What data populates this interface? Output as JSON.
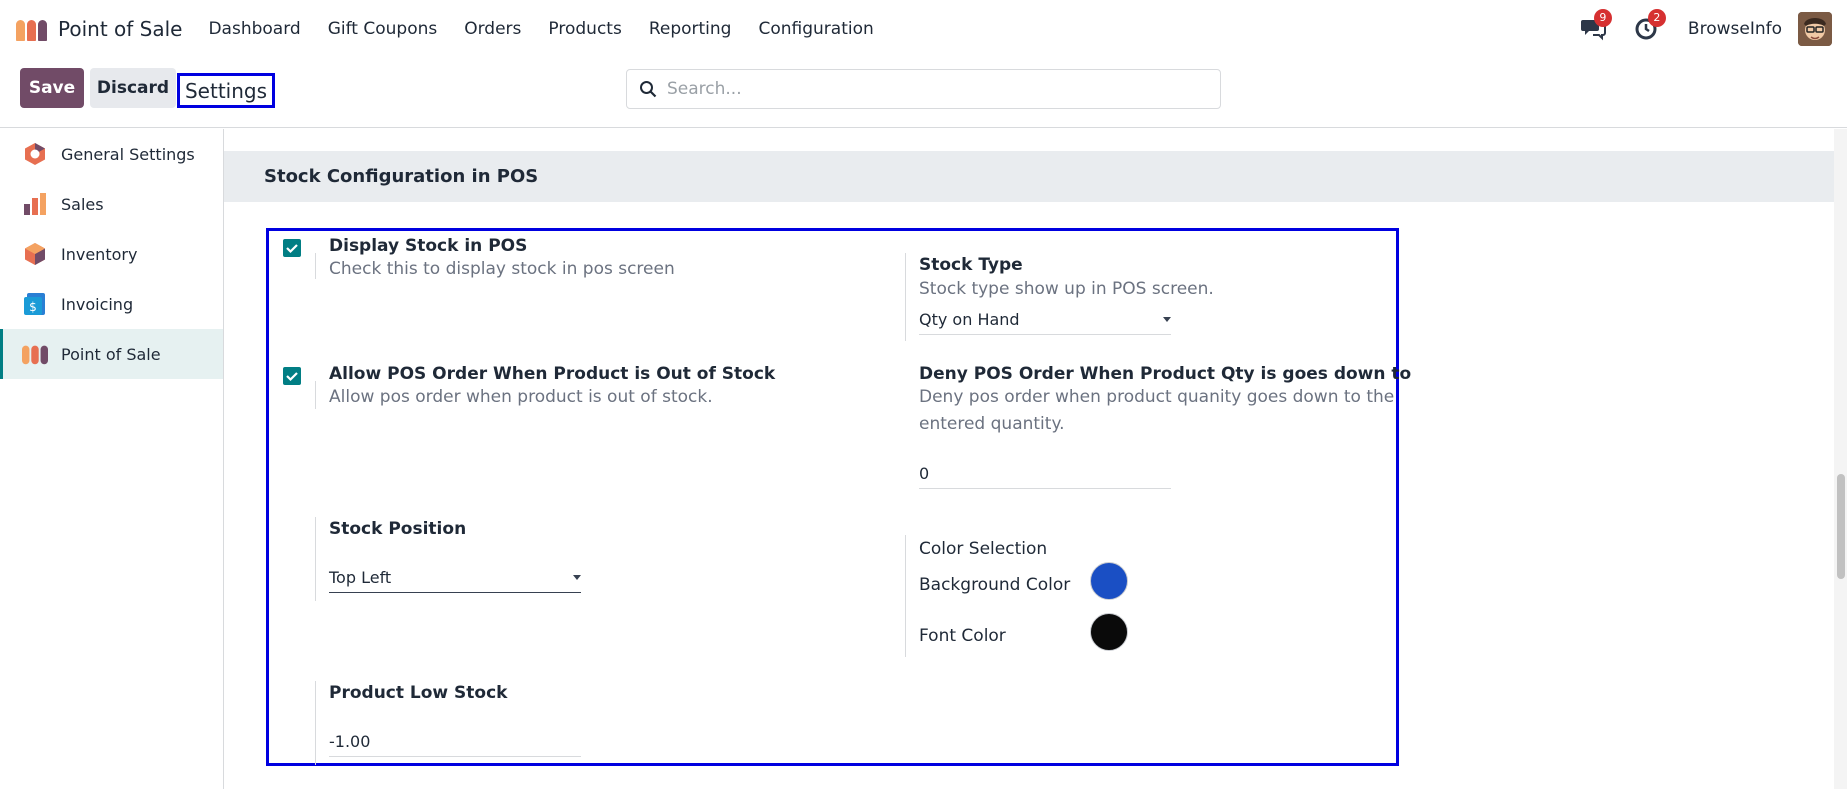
{
  "navbar": {
    "app_title": "Point of Sale",
    "menu": [
      "Dashboard",
      "Gift Coupons",
      "Orders",
      "Products",
      "Reporting",
      "Configuration"
    ],
    "messages_count": "9",
    "activities_count": "2",
    "user_name": "BrowseInfo"
  },
  "control": {
    "save_label": "Save",
    "discard_label": "Discard",
    "breadcrumb": "Settings",
    "search_placeholder": "Search..."
  },
  "sidebar": {
    "items": [
      {
        "label": "General Settings",
        "icon": "general-settings-icon"
      },
      {
        "label": "Sales",
        "icon": "sales-icon"
      },
      {
        "label": "Inventory",
        "icon": "inventory-icon"
      },
      {
        "label": "Invoicing",
        "icon": "invoicing-icon"
      },
      {
        "label": "Point of Sale",
        "icon": "point-of-sale-icon",
        "active": true
      }
    ]
  },
  "section": {
    "title": "Stock Configuration in POS"
  },
  "settings": {
    "display_stock": {
      "title": "Display Stock in POS",
      "desc": "Check this to display stock in pos screen",
      "checked": true
    },
    "stock_type": {
      "title": "Stock Type",
      "desc": "Stock type show up in POS screen.",
      "value": "Qty on Hand"
    },
    "allow_order": {
      "title": "Allow POS Order When Product is Out of Stock",
      "desc": "Allow pos order when product is out of stock.",
      "checked": true
    },
    "deny_order": {
      "title": "Deny POS Order When Product Qty is goes down to",
      "desc_line1": "Deny pos order when product quanity goes down to the",
      "desc_line2": "entered quantity.",
      "value": "0"
    },
    "stock_position": {
      "title": "Stock Position",
      "value": "Top Left"
    },
    "color_selection": {
      "title": "Color Selection",
      "background_label": "Background Color",
      "background_color": "#1a4fc4",
      "font_label": "Font Color",
      "font_color": "#0a0a0a"
    },
    "low_stock": {
      "title": "Product Low Stock",
      "value": "-1.00"
    }
  },
  "colors": {
    "primary": "#714b67",
    "accent": "#017e84",
    "highlight_border": "#0000e0"
  }
}
